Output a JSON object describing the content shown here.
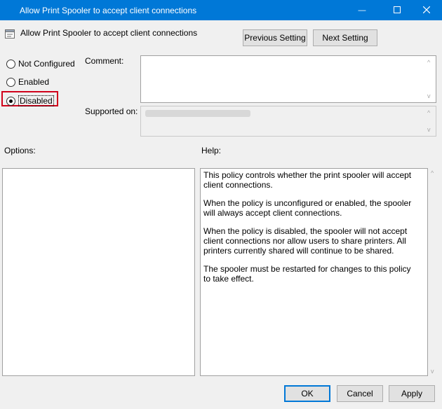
{
  "window": {
    "title": "Allow Print Spooler to accept client connections",
    "minimize_glyph": "—",
    "maximize_glyph": "☐",
    "close_glyph": "✕"
  },
  "header": {
    "policy_name": "Allow Print Spooler to accept client connections",
    "previous_setting": "Previous Setting",
    "next_setting": "Next Setting"
  },
  "state": {
    "options": [
      {
        "label": "Not Configured",
        "selected": false
      },
      {
        "label": "Enabled",
        "selected": false
      },
      {
        "label": "Disabled",
        "selected": true
      }
    ],
    "highlight_color": "#d0021b"
  },
  "comment": {
    "label": "Comment:",
    "value": ""
  },
  "supported_on": {
    "label": "Supported on:",
    "value": ""
  },
  "options_panel": {
    "label": "Options:"
  },
  "help": {
    "label": "Help:",
    "paragraphs": [
      "This policy controls whether the print spooler will accept client connections.",
      "When the policy is unconfigured or enabled, the spooler will always accept client connections.",
      "When the policy is disabled, the spooler will not accept client connections nor allow users to share printers.  All printers currently shared will continue to be shared.",
      "The spooler must be restarted for changes to this policy to take effect."
    ]
  },
  "footer": {
    "ok": "OK",
    "cancel": "Cancel",
    "apply": "Apply"
  },
  "colors": {
    "titlebar": "#0078d7",
    "window_bg": "#f0f0f0"
  }
}
